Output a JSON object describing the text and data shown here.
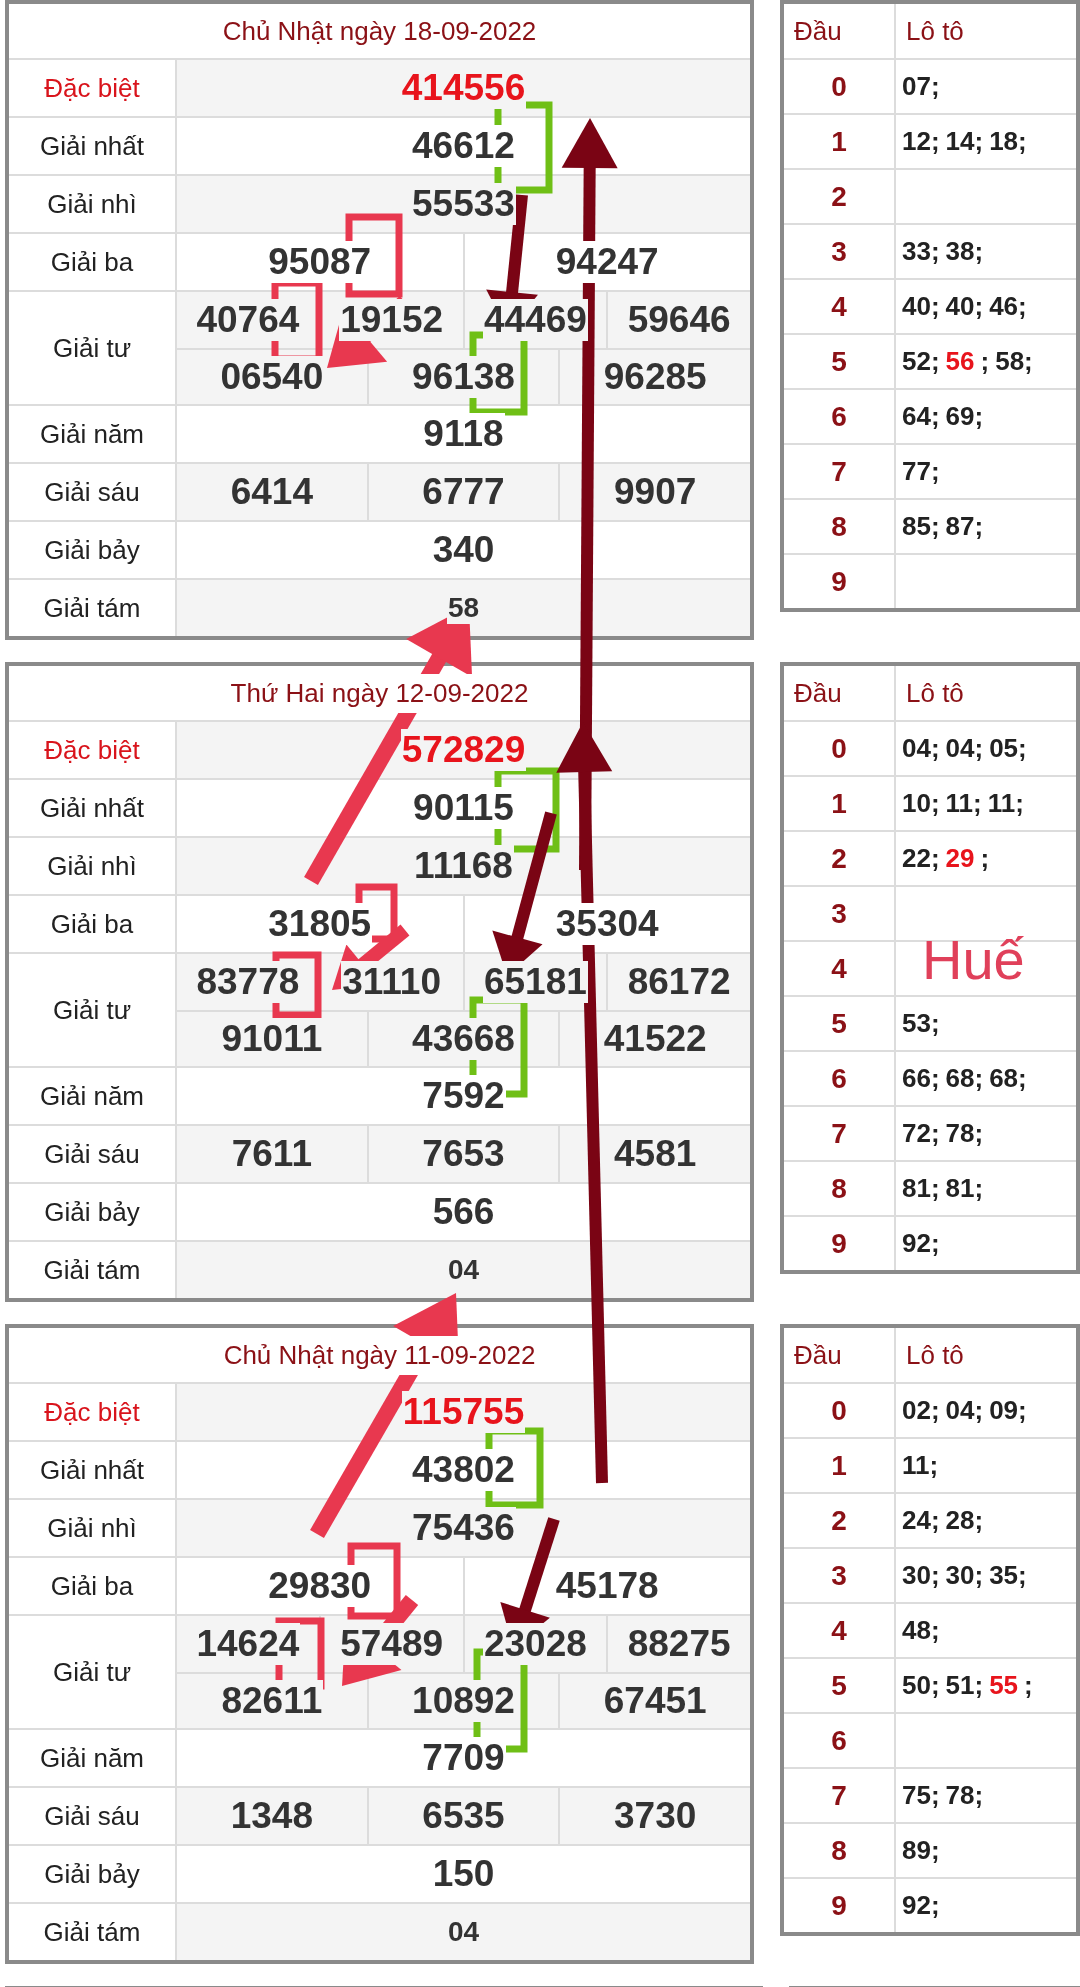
{
  "blocks": [
    {
      "title": "Chủ Nhật ngày 18-09-2022",
      "prizes": [
        {
          "label": "Đặc biệt",
          "kind": "special",
          "numbers": [
            "414556"
          ]
        },
        {
          "label": "Giải nhất",
          "kind": "normal",
          "numbers": [
            "46612"
          ]
        },
        {
          "label": "Giải nhì",
          "kind": "normal",
          "numbers": [
            "55533"
          ]
        },
        {
          "label": "Giải ba",
          "kind": "normal",
          "numbers": [
            "95087",
            "94247"
          ]
        },
        {
          "label": "Giải tư",
          "kind": "normal",
          "numbers": [
            "40764",
            "19152",
            "44469",
            "59646",
            "06540",
            "96138",
            "96285"
          ]
        },
        {
          "label": "Giải năm",
          "kind": "normal",
          "numbers": [
            "9118"
          ]
        },
        {
          "label": "Giải sáu",
          "kind": "normal",
          "numbers": [
            "6414",
            "6777",
            "9907"
          ]
        },
        {
          "label": "Giải bảy",
          "kind": "normal",
          "numbers": [
            "340"
          ]
        },
        {
          "label": "Giải tám",
          "kind": "small",
          "numbers": [
            "58"
          ]
        }
      ],
      "loto": {
        "head_label": "Đầu",
        "values_label": "Lô tô",
        "rows": [
          {
            "head": "0",
            "items": [
              {
                "text": "07;",
                "highlight": false
              }
            ]
          },
          {
            "head": "1",
            "items": [
              {
                "text": "12;",
                "highlight": false
              },
              {
                "text": "14;",
                "highlight": false
              },
              {
                "text": "18;",
                "highlight": false
              }
            ]
          },
          {
            "head": "2",
            "items": []
          },
          {
            "head": "3",
            "items": [
              {
                "text": "33;",
                "highlight": false
              },
              {
                "text": "38;",
                "highlight": false
              }
            ]
          },
          {
            "head": "4",
            "items": [
              {
                "text": "40;",
                "highlight": false
              },
              {
                "text": "40;",
                "highlight": false
              },
              {
                "text": "46;",
                "highlight": false
              }
            ]
          },
          {
            "head": "5",
            "items": [
              {
                "text": "52;",
                "highlight": false
              },
              {
                "text": "56",
                "highlight": true
              },
              {
                "text": ";",
                "highlight": false
              },
              {
                "text": "58;",
                "highlight": false
              }
            ]
          },
          {
            "head": "6",
            "items": [
              {
                "text": "64;",
                "highlight": false
              },
              {
                "text": "69;",
                "highlight": false
              }
            ]
          },
          {
            "head": "7",
            "items": [
              {
                "text": "77;",
                "highlight": false
              }
            ]
          },
          {
            "head": "8",
            "items": [
              {
                "text": "85;",
                "highlight": false
              },
              {
                "text": "87;",
                "highlight": false
              }
            ]
          },
          {
            "head": "9",
            "items": []
          }
        ]
      }
    },
    {
      "title": "Thứ Hai ngày 12-09-2022",
      "prizes": [
        {
          "label": "Đặc biệt",
          "kind": "special",
          "numbers": [
            "572829"
          ]
        },
        {
          "label": "Giải nhất",
          "kind": "normal",
          "numbers": [
            "90115"
          ]
        },
        {
          "label": "Giải nhì",
          "kind": "normal",
          "numbers": [
            "11168"
          ]
        },
        {
          "label": "Giải ba",
          "kind": "normal",
          "numbers": [
            "31805",
            "35304"
          ]
        },
        {
          "label": "Giải tư",
          "kind": "normal",
          "numbers": [
            "83778",
            "31110",
            "65181",
            "86172",
            "91011",
            "43668",
            "41522"
          ]
        },
        {
          "label": "Giải năm",
          "kind": "normal",
          "numbers": [
            "7592"
          ]
        },
        {
          "label": "Giải sáu",
          "kind": "normal",
          "numbers": [
            "7611",
            "7653",
            "4581"
          ]
        },
        {
          "label": "Giải bảy",
          "kind": "normal",
          "numbers": [
            "566"
          ]
        },
        {
          "label": "Giải tám",
          "kind": "small",
          "numbers": [
            "04"
          ]
        }
      ],
      "loto": {
        "head_label": "Đầu",
        "values_label": "Lô tô",
        "rows": [
          {
            "head": "0",
            "items": [
              {
                "text": "04;",
                "highlight": false
              },
              {
                "text": "04;",
                "highlight": false
              },
              {
                "text": "05;",
                "highlight": false
              }
            ]
          },
          {
            "head": "1",
            "items": [
              {
                "text": "10;",
                "highlight": false
              },
              {
                "text": "11;",
                "highlight": false
              },
              {
                "text": "11;",
                "highlight": false
              }
            ]
          },
          {
            "head": "2",
            "items": [
              {
                "text": "22;",
                "highlight": false
              },
              {
                "text": "29",
                "highlight": true
              },
              {
                "text": ";",
                "highlight": false
              }
            ]
          },
          {
            "head": "3",
            "items": []
          },
          {
            "head": "4",
            "items": []
          },
          {
            "head": "5",
            "items": [
              {
                "text": "53;",
                "highlight": false
              }
            ]
          },
          {
            "head": "6",
            "items": [
              {
                "text": "66;",
                "highlight": false
              },
              {
                "text": "68;",
                "highlight": false
              },
              {
                "text": "68;",
                "highlight": false
              }
            ]
          },
          {
            "head": "7",
            "items": [
              {
                "text": "72;",
                "highlight": false
              },
              {
                "text": "78;",
                "highlight": false
              }
            ]
          },
          {
            "head": "8",
            "items": [
              {
                "text": "81;",
                "highlight": false
              },
              {
                "text": "81;",
                "highlight": false
              }
            ]
          },
          {
            "head": "9",
            "items": [
              {
                "text": "92;",
                "highlight": false
              }
            ]
          }
        ]
      }
    },
    {
      "title": "Chủ Nhật ngày 11-09-2022",
      "prizes": [
        {
          "label": "Đặc biệt",
          "kind": "special",
          "numbers": [
            "115755"
          ]
        },
        {
          "label": "Giải nhất",
          "kind": "normal",
          "numbers": [
            "43802"
          ]
        },
        {
          "label": "Giải nhì",
          "kind": "normal",
          "numbers": [
            "75436"
          ]
        },
        {
          "label": "Giải ba",
          "kind": "normal",
          "numbers": [
            "29830",
            "45178"
          ]
        },
        {
          "label": "Giải tư",
          "kind": "normal",
          "numbers": [
            "14624",
            "57489",
            "23028",
            "88275",
            "82611",
            "10892",
            "67451"
          ]
        },
        {
          "label": "Giải năm",
          "kind": "normal",
          "numbers": [
            "7709"
          ]
        },
        {
          "label": "Giải sáu",
          "kind": "normal",
          "numbers": [
            "1348",
            "6535",
            "3730"
          ]
        },
        {
          "label": "Giải bảy",
          "kind": "normal",
          "numbers": [
            "150"
          ]
        },
        {
          "label": "Giải tám",
          "kind": "small",
          "numbers": [
            "04"
          ]
        }
      ],
      "loto": {
        "head_label": "Đầu",
        "values_label": "Lô tô",
        "rows": [
          {
            "head": "0",
            "items": [
              {
                "text": "02;",
                "highlight": false
              },
              {
                "text": "04;",
                "highlight": false
              },
              {
                "text": "09;",
                "highlight": false
              }
            ]
          },
          {
            "head": "1",
            "items": [
              {
                "text": "11;",
                "highlight": false
              }
            ]
          },
          {
            "head": "2",
            "items": [
              {
                "text": "24;",
                "highlight": false
              },
              {
                "text": "28;",
                "highlight": false
              }
            ]
          },
          {
            "head": "3",
            "items": [
              {
                "text": "30;",
                "highlight": false
              },
              {
                "text": "30;",
                "highlight": false
              },
              {
                "text": "35;",
                "highlight": false
              }
            ]
          },
          {
            "head": "4",
            "items": [
              {
                "text": "48;",
                "highlight": false
              }
            ]
          },
          {
            "head": "5",
            "items": [
              {
                "text": "50;",
                "highlight": false
              },
              {
                "text": "51;",
                "highlight": false
              },
              {
                "text": "55",
                "highlight": true
              },
              {
                "text": ";",
                "highlight": false
              }
            ]
          },
          {
            "head": "6",
            "items": []
          },
          {
            "head": "7",
            "items": [
              {
                "text": "75;",
                "highlight": false
              },
              {
                "text": "78;",
                "highlight": false
              }
            ]
          },
          {
            "head": "8",
            "items": [
              {
                "text": "89;",
                "highlight": false
              }
            ]
          },
          {
            "head": "9",
            "items": [
              {
                "text": "92;",
                "highlight": false
              }
            ]
          }
        ]
      }
    }
  ],
  "overlay_label": "Huế"
}
